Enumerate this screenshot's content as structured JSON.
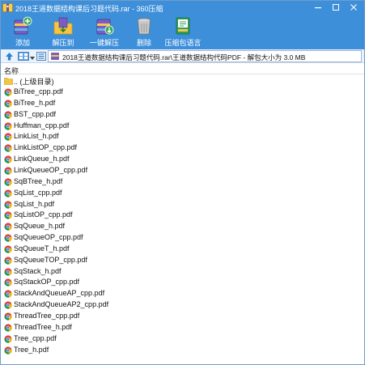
{
  "window": {
    "title": "2018王道数据结构课后习题代码.rar - 360压缩"
  },
  "toolbar": {
    "add_label": "添加",
    "extract_to_label": "解压到",
    "one_click_extract_label": "一键解压",
    "delete_label": "删除",
    "sfx_label": "压缩包语言"
  },
  "addressbar": {
    "path": "2018王道数据结构课后习题代码.rar\\王道数据结构代码PDF - 解包大小为 3.0 MB"
  },
  "list": {
    "column_name": "名称",
    "parent_dir": ".. (上级目录)",
    "files": [
      "BiTree_cpp.pdf",
      "BiTree_h.pdf",
      "BST_cpp.pdf",
      "Huffman_cpp.pdf",
      "LinkList_h.pdf",
      "LinkListOP_cpp.pdf",
      "LinkQueue_h.pdf",
      "LinkQueueOP_cpp.pdf",
      "SqBTree_h.pdf",
      "SqList_cpp.pdf",
      "SqList_h.pdf",
      "SqListOP_cpp.pdf",
      "SqQueue_h.pdf",
      "SqQueueOP_cpp.pdf",
      "SqQueueT_h.pdf",
      "SqQueueTOP_cpp.pdf",
      "SqStack_h.pdf",
      "SqStackOP_cpp.pdf",
      "StackAndQueueAP_cpp.pdf",
      "StackAndQueueAP2_cpp.pdf",
      "ThreadTree_cpp.pdf",
      "ThreadTree_h.pdf",
      "Tree_cpp.pdf",
      "Tree_h.pdf"
    ]
  },
  "icons": {
    "titlebar": "archive-app-icon",
    "add": "add-archive-icon",
    "extract_to": "extract-to-folder-icon",
    "one_click": "one-click-extract-icon",
    "delete": "trash-icon",
    "sfx": "archive-language-icon",
    "up": "up-arrow-icon",
    "folder": "folder-icon",
    "file": "chrome-pdf-file-icon"
  },
  "colors": {
    "titlebar": "#3d8fda",
    "address_bg": "#eaf2fb",
    "folder": "#f5c542"
  }
}
